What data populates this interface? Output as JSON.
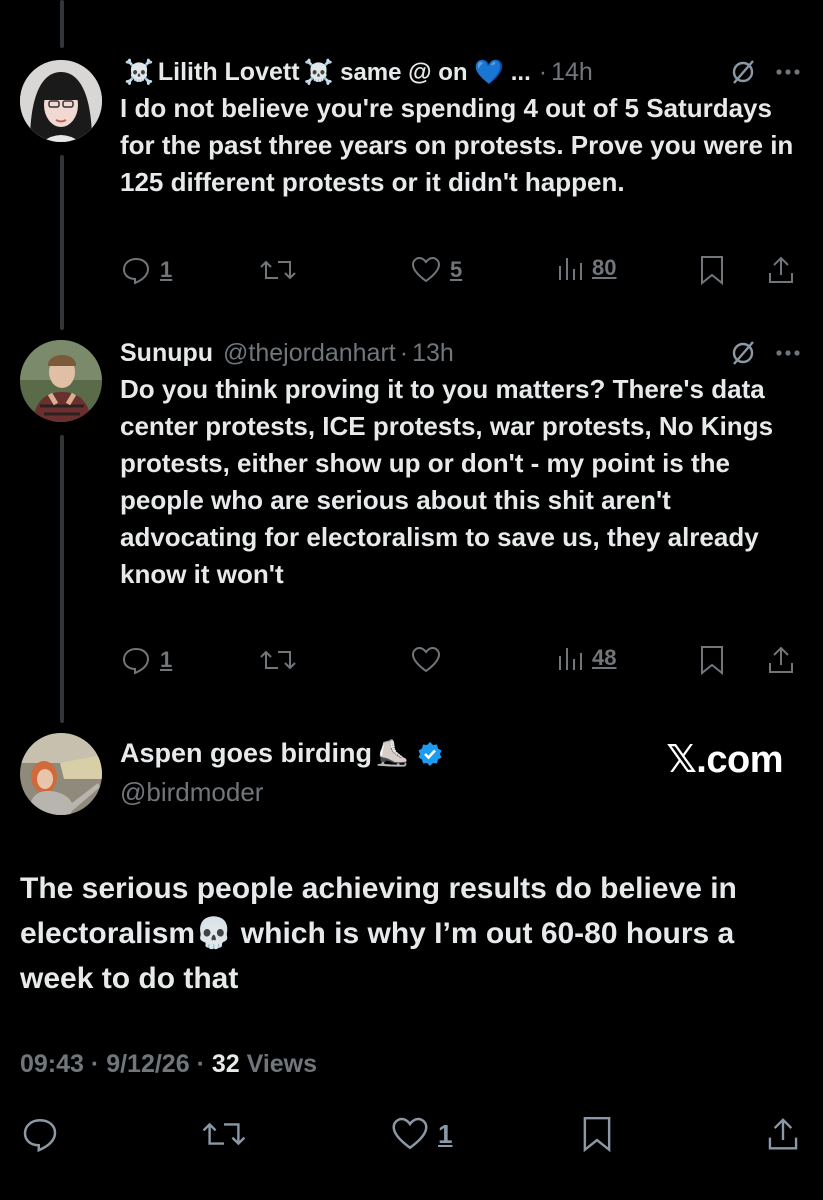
{
  "replies": [
    {
      "name": "Lilith Lovett",
      "name_prefix": "☠️",
      "name_suffix": "☠️ same @ on 💙 ...",
      "separator": "·",
      "time": "14h",
      "text": "I do not believe you're spending 4 out of 5 Saturdays for the past three years on protests. Prove you were in 125 different protests or it didn't happen.",
      "replies_count": "1",
      "likes_count": "5",
      "views_count": "80"
    },
    {
      "name": "Sunupu",
      "handle": "@thejordanhart",
      "separator": "·",
      "time": "13h",
      "text": "Do you think proving it to you matters?  There's data center protests, ICE protests, war protests, No Kings protests, either show up or don't - my point is the people who are serious about this shit aren't advocating for electoralism to save us, they already know it won't",
      "replies_count": "1",
      "likes_count": "",
      "views_count": "48"
    }
  ],
  "main_post": {
    "name": "Aspen goes birding",
    "name_emoji": "⛸️",
    "handle": "@birdmoder",
    "watermark": "𝕏.com",
    "text_part1": "The serious people achieving results do believe in electoralism",
    "text_emoji": "💀",
    "text_part2": " which is why I’m out 60-80 hours a week to do that",
    "time": "09:43",
    "date": "9/12/26",
    "separator": "·",
    "views_count": "32",
    "views_label": "Views",
    "likes_count": "1",
    "accent": "#1d9bf0"
  },
  "colors": {
    "background": "#000000",
    "text": "#e7e9ea",
    "muted": "#71767b",
    "verified": "#1d9bf0"
  }
}
